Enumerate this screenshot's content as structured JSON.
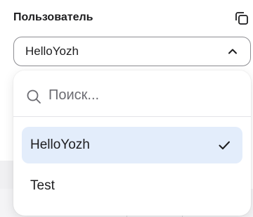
{
  "field": {
    "label": "Пользователь",
    "selected_value": "HelloYozh",
    "copy_icon": "copy-icon",
    "chevron_icon": "chevron-up-icon"
  },
  "dropdown": {
    "search": {
      "placeholder": "Поиск...",
      "value": "",
      "icon": "search-icon"
    },
    "options": [
      {
        "label": "HelloYozh",
        "selected": true,
        "icon": "check-icon"
      },
      {
        "label": "Test",
        "selected": false
      }
    ]
  },
  "colors": {
    "selected_bg": "#e3edfb",
    "border": "#8e8e93",
    "text": "#1d1d1f"
  }
}
